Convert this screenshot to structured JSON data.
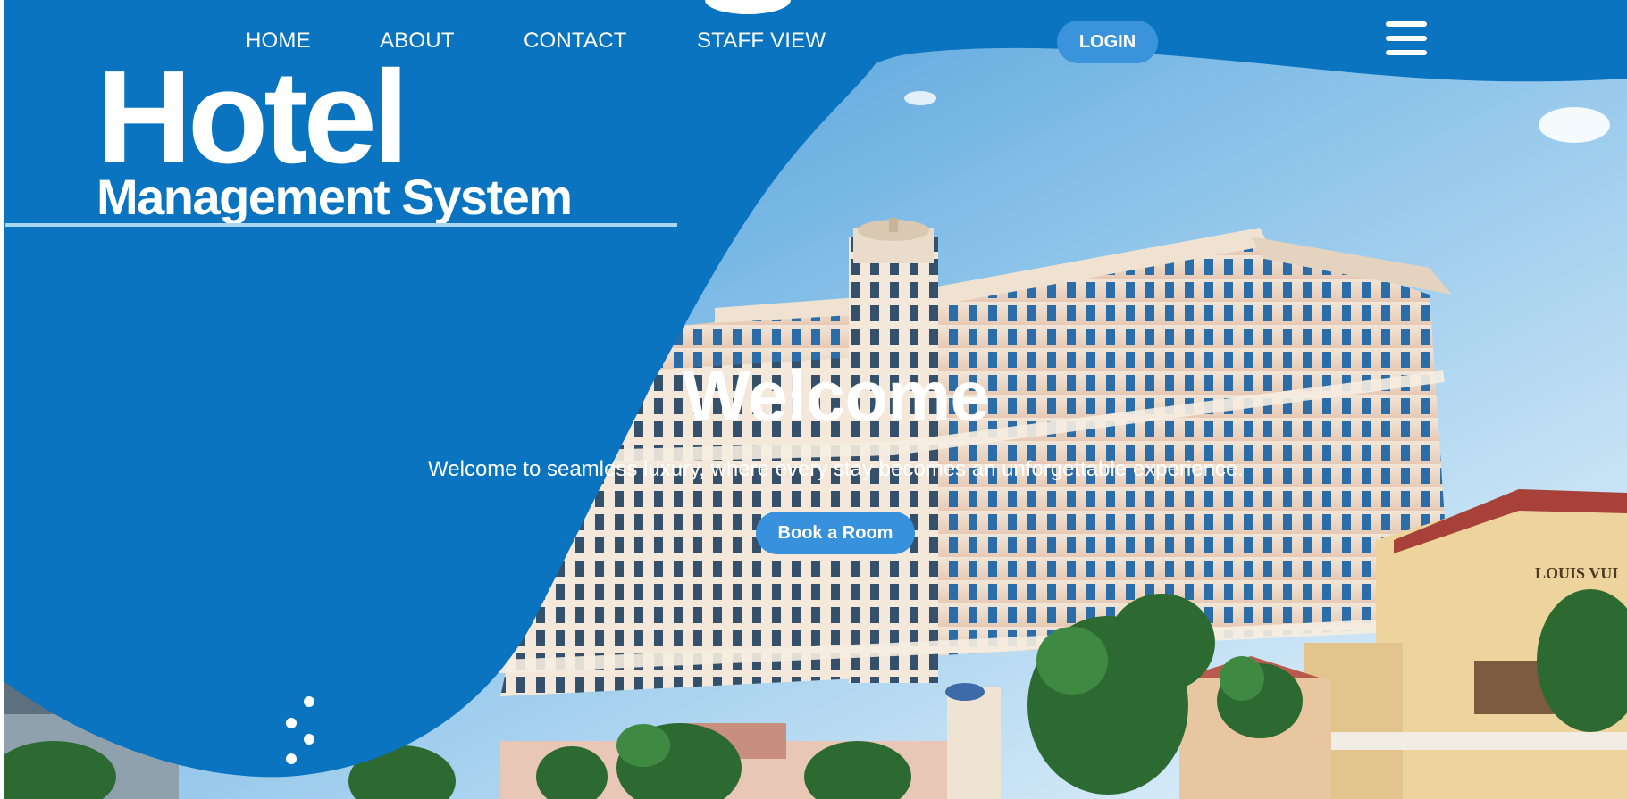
{
  "nav": {
    "links": [
      "HOME",
      "ABOUT",
      "CONTACT",
      "STAFF VIEW"
    ],
    "login_label": "LOGIN",
    "menu_icon": "hamburger-menu-icon"
  },
  "logo": {
    "title": "Hotel",
    "subtitle": "Management System"
  },
  "hero": {
    "title": "Welcome",
    "subtitle": "Welcome to seamless luxury, where every stay becomes an unforgettable experience.",
    "cta_label": "Book a Room"
  },
  "photo": {
    "sign_text": "LOUIS VUI"
  },
  "colors": {
    "brand_blue": "#0a74c0",
    "button_blue": "#3b93dc",
    "sky_light": "#d5ebf8"
  }
}
